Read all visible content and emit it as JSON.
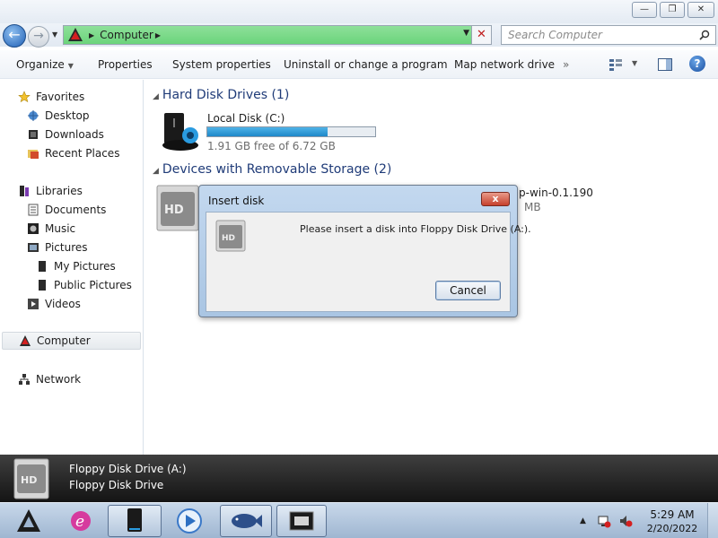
{
  "window": {
    "caption_buttons": [
      "minimize",
      "maximize",
      "close"
    ]
  },
  "address_bar": {
    "segments": [
      "Computer"
    ],
    "background_color": "#7bd888"
  },
  "search": {
    "placeholder": "Search Computer"
  },
  "command_bar": {
    "organize": "Organize",
    "properties": "Properties",
    "system_properties": "System properties",
    "uninstall": "Uninstall or change a program",
    "map_drive": "Map network drive",
    "overflow": "»"
  },
  "nav_pane": {
    "favorites": "Favorites",
    "desktop": "Desktop",
    "downloads": "Downloads",
    "recent_places": "Recent Places",
    "libraries": "Libraries",
    "documents": "Documents",
    "music": "Music",
    "pictures": "Pictures",
    "my_pictures": "My Pictures",
    "public_pictures": "Public Pictures",
    "videos": "Videos",
    "computer": "Computer",
    "network": "Network"
  },
  "content": {
    "hard_disk_group": "Hard Disk Drives (1)",
    "local_disk": {
      "name": "Local Disk (C:)",
      "free_text": "1.91 GB free of 6.72 GB",
      "used_fraction": 0.716
    },
    "removable_group": "Devices with Removable Storage (2)",
    "removable_item_name_partial": "p-win-0.1.190",
    "removable_item_size_partial": "MB"
  },
  "dialog": {
    "title": "Insert disk",
    "close_label": "x",
    "message": "Please insert a disk into Floppy Disk Drive (A:).",
    "cancel": "Cancel"
  },
  "details": {
    "name": "Floppy Disk Drive (A:)",
    "type": "Floppy Disk Drive"
  },
  "clock": {
    "time": "5:29 AM",
    "date": "2/20/2022"
  },
  "tray": {
    "show_hidden": "▲"
  }
}
